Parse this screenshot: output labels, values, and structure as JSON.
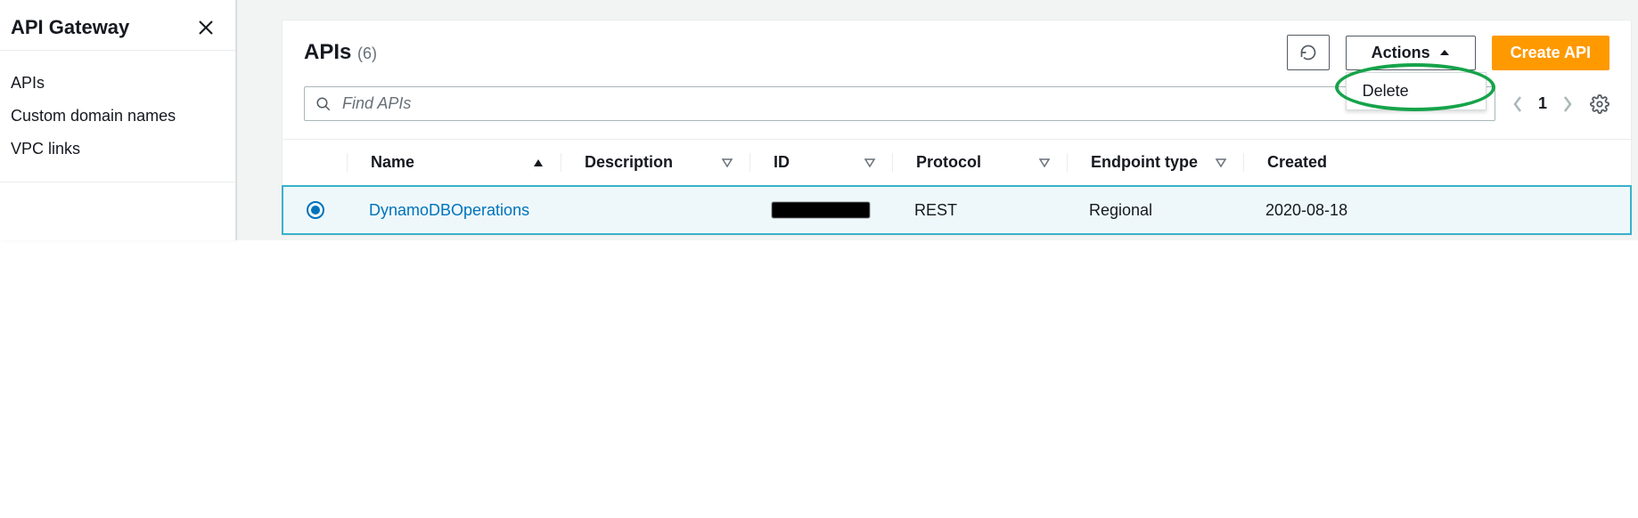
{
  "sidebar": {
    "title": "API Gateway",
    "items": [
      {
        "label": "APIs"
      },
      {
        "label": "Custom domain names"
      },
      {
        "label": "VPC links"
      }
    ]
  },
  "header": {
    "title": "APIs",
    "count": "(6)",
    "actions_label": "Actions",
    "create_label": "Create API",
    "dropdown": {
      "delete": "Delete"
    }
  },
  "search": {
    "placeholder": "Find APIs"
  },
  "pager": {
    "page": "1"
  },
  "columns": {
    "name": "Name",
    "description": "Description",
    "id": "ID",
    "protocol": "Protocol",
    "endpoint": "Endpoint type",
    "created": "Created"
  },
  "rows": [
    {
      "selected": true,
      "name": "DynamoDBOperations",
      "description": "",
      "id": "██████",
      "protocol": "REST",
      "endpoint": "Regional",
      "created": "2020-08-18"
    }
  ]
}
